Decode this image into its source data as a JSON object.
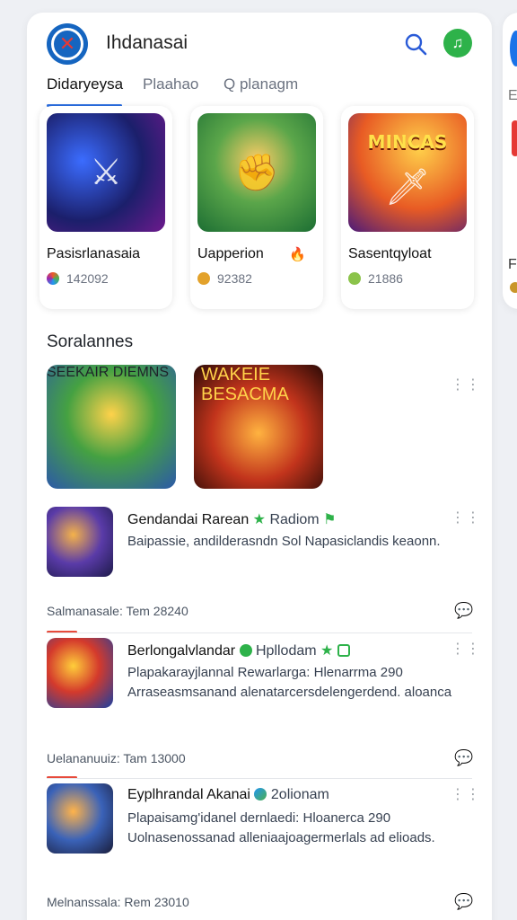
{
  "header": {
    "title": "Ihdanasai"
  },
  "tabs": [
    "Didaryeysa",
    "Plaahao",
    "Q planagm"
  ],
  "featured": [
    {
      "name": "Pasisrlanasaia",
      "count": "142092",
      "dot_color": "#f05a28"
    },
    {
      "name": "Uapperion",
      "count": "92382",
      "dot_color": "#e3a22b"
    },
    {
      "name": "Sasentqyloat",
      "count": "21886",
      "dot_color": "#8bc34a"
    }
  ],
  "featured_art_text": {
    "c": "MINCAS"
  },
  "section": {
    "title": "Soralannes",
    "art_d_text": "SEEKAIR DIEMNS",
    "art_e_text": "WAKEIE BESACMA"
  },
  "list": [
    {
      "title": "Gendandai Rarean",
      "tag": "Radiom",
      "desc": "Baipassie, andilderasndn Sol Napasiclandis keaonn.",
      "footer": "Salmanasale: Tem 28240",
      "accent": "#e74a3b"
    },
    {
      "title": "Berlongalvlandar",
      "tag": "Hpllodam",
      "desc": "Plapakarayjlannal Rewarlarga: Hlenarrma 290 Arraseasmsanand alenatarcersdelengerdend. aloanca",
      "footer": "Uelananuuiz: Tam 13000",
      "accent": "#e74a3b"
    },
    {
      "title": "Eyplhrandal Akanai",
      "tag": "2olionam",
      "desc": "Plapaisamg'idanel dernlaedi: Hloanerca 290 Uolnasenossanad alleniaajoagermerlals ad elioads.",
      "footer": "Melnanssala: Rem 23010",
      "accent": "#7b8fd9"
    }
  ],
  "colors": {
    "accent": "#2a6de0",
    "brand_green": "#2eb24a",
    "fire_red": "#e53935"
  },
  "icons": [
    "search-icon",
    "music-note-icon",
    "more-dots-icon",
    "comment-icon",
    "star-icon",
    "fire-icon"
  ]
}
